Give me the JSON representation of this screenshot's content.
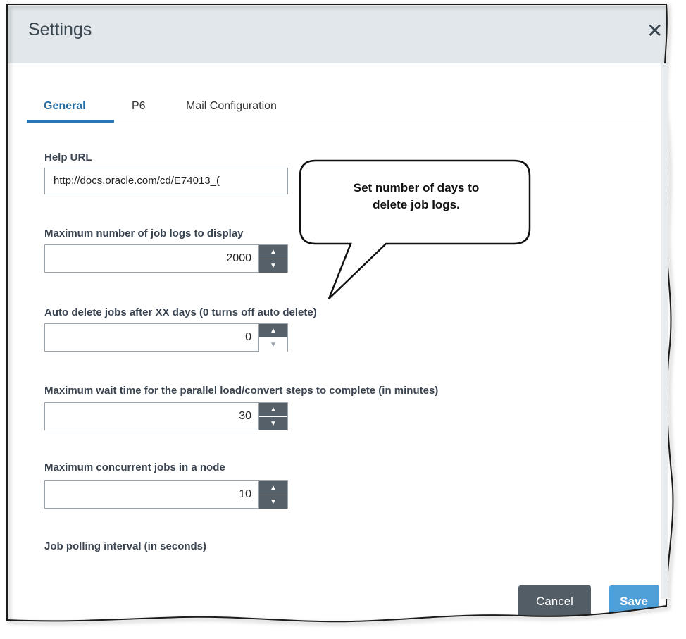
{
  "dialog": {
    "title": "Settings",
    "close_glyph": "✕",
    "scroll_glyph": "^"
  },
  "tabs": [
    {
      "label": "General",
      "active": true
    },
    {
      "label": "P6",
      "active": false
    },
    {
      "label": "Mail Configuration",
      "active": false
    }
  ],
  "fields": {
    "help_url": {
      "label": "Help URL",
      "value": "http://docs.oracle.com/cd/E74013_("
    },
    "max_job_logs": {
      "label": "Maximum number of job logs to display",
      "value": "2000"
    },
    "auto_delete": {
      "label": "Auto delete jobs after XX days (0 turns off auto delete)",
      "value": "0"
    },
    "max_wait": {
      "label": "Maximum wait time for the parallel load/convert steps to complete (in minutes)",
      "value": "30"
    },
    "max_concurrent": {
      "label": "Maximum concurrent jobs in a node",
      "value": "10"
    },
    "polling_interval": {
      "label": "Job polling interval (in seconds)"
    }
  },
  "spinner_glyphs": {
    "up": "▲",
    "down": "▼"
  },
  "callout": {
    "line1": "Set number of days to",
    "line2": "delete job logs."
  },
  "footer": {
    "cancel_label": "Cancel",
    "save_label": "Save"
  },
  "colors": {
    "header_bg": "#e1e7ea",
    "tab_active": "#2a6ea1",
    "cancel_bg": "#535d66",
    "save_bg": "#4f9fd9"
  }
}
